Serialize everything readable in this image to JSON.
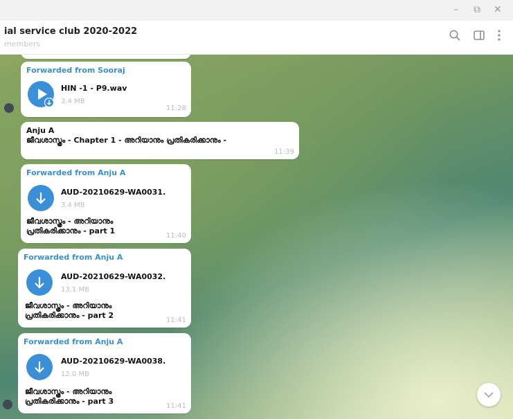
{
  "window": {
    "minimize_glyph": "–",
    "maximize_glyph": "⧉",
    "close_glyph": "✕"
  },
  "header": {
    "title": "ial service club 2020-2022",
    "subtitle": "members",
    "icons": [
      "search-icon",
      "sidebar-toggle-icon",
      "more-options-icon"
    ]
  },
  "messages": [
    {
      "kind": "audio",
      "forwarded_from": "Forwarded from Sooraj",
      "file_name": "HIN -1 - P9.wav",
      "file_size": "3.4 MB",
      "time": "11:28"
    },
    {
      "kind": "text",
      "sender": "Anju A",
      "text": "ജീവശാസ്ത്രം - Chapter 1 - അറിയാനും പ്രതികരിക്കാനും -",
      "time": "11:39"
    },
    {
      "kind": "file",
      "forwarded_from": "Forwarded from Anju A",
      "file_name": "AUD-20210629-WA0031.",
      "file_size": "3.4 MB",
      "caption_line1": "ജീവശാസ്ത്രം - അറിയാനും",
      "caption_line2": "പ്രതികരിക്കാനും - part 1",
      "time": "11:40"
    },
    {
      "kind": "file",
      "forwarded_from": "Forwarded from Anju A",
      "file_name": "AUD-20210629-WA0032.",
      "file_size": "13.1 MB",
      "caption_line1": "ജീവശാസ്ത്രം - അറിയാനും",
      "caption_line2": "പ്രതികരിക്കാനും - part 2",
      "time": "11:41"
    },
    {
      "kind": "file",
      "forwarded_from": "Forwarded from Anju A",
      "file_name": "AUD-20210629-WA0038.",
      "file_size": "12.0 MB",
      "caption_line1": "ജീവശാസ്ത്രം - അറിയാനും",
      "caption_line2": "പ്രതികരിക്കാനും - part 3",
      "time": "11:41"
    }
  ],
  "colors": {
    "accent": "#3a8fd6",
    "forward_label": "#3a8fd0",
    "bubble": "#ffffff"
  }
}
